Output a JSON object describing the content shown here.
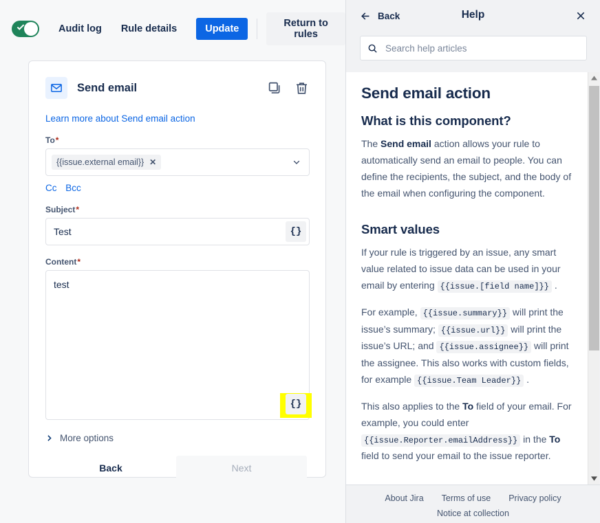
{
  "toolbar": {
    "toggle_state": "on",
    "audit_log": "Audit log",
    "rule_details": "Rule details",
    "update": "Update",
    "return_to_rules": "Return to rules",
    "primary_color": "#0C66E4",
    "toggle_color": "#1F845A"
  },
  "card": {
    "title": "Send email",
    "learn_more": "Learn more about Send email action",
    "to": {
      "label": "To",
      "required": "*",
      "chip": "{{issue.external email}}",
      "chip_remove": "✕"
    },
    "cc": "Cc",
    "bcc": "Bcc",
    "subject": {
      "label": "Subject",
      "required": "*",
      "value": "Test",
      "smart_values_button": "{}"
    },
    "content": {
      "label": "Content",
      "required": "*",
      "value": "test",
      "smart_values_button": "{}",
      "highlight_color": "#FFFF00"
    },
    "more_options": "More options",
    "back": "Back",
    "next": "Next"
  },
  "help": {
    "back": "Back",
    "title": "Help",
    "close": "✕",
    "search_placeholder": "Search help articles",
    "search_value": "",
    "article": {
      "title": "Send email action",
      "section1_heading": "What is this component?",
      "p1_a": "The ",
      "p1_b": "Send email",
      "p1_c": " action allows your rule to automatically send an email to people. You can define the recipients, the subject, and the body of the email when configuring the component.",
      "section2_heading": "Smart values",
      "p2_a": "If your rule is triggered by an issue, any smart value related to issue data can be used in your email by entering ",
      "p2_code": "{{issue.[field name]}}",
      "p2_b": " .",
      "p3_a": "For example, ",
      "p3_code1": "{{issue.summary}}",
      "p3_b": " will print the issue’s summary; ",
      "p3_code2": "{{issue.url}}",
      "p3_c": " will print the issue’s URL; and ",
      "p3_code3": "{{issue.assignee}}",
      "p3_d": " will print the assignee. This also works with custom fields, for example ",
      "p3_code4": "{{issue.Team Leader}}",
      "p3_e": " .",
      "p4_a": "This also applies to the ",
      "p4_b": "To",
      "p4_c": " field of your email. For example, you could enter ",
      "p4_code": "{{issue.Reporter.emailAddress}}",
      "p4_d": " in the ",
      "p4_e": "To",
      "p4_f": " field to send your email to the issue reporter."
    },
    "footer": {
      "about": "About Jira",
      "terms": "Terms of use",
      "privacy": "Privacy policy",
      "notice": "Notice at collection"
    }
  }
}
